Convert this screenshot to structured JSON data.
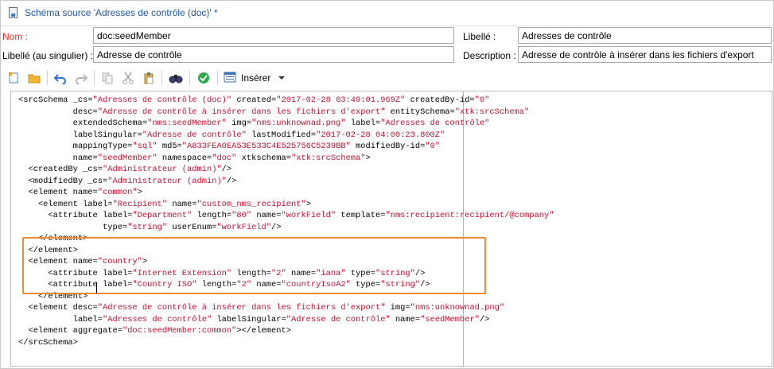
{
  "window": {
    "title": "Schéma source 'Adresses de contrôle (doc)' *"
  },
  "form": {
    "name_label": "Nom :",
    "name_value": "doc:seedMember",
    "label_label": "Libellé :",
    "label_value": "Adresses de contrôle",
    "singular_label": "Libellé (au singulier) :",
    "singular_value": "Adresse de contrôle",
    "description_label": "Description :",
    "description_value": "Adresse de contrôle à insérer dans les fichiers d'export"
  },
  "toolbar": {
    "insert_label": "Insérer",
    "icons": [
      "new-icon",
      "open-icon",
      "undo-icon",
      "redo-icon",
      "copy-icon",
      "cut-icon",
      "paste-icon",
      "find-icon",
      "check-icon",
      "insert-icon"
    ]
  },
  "editor": {
    "lines": [
      "<srcSchema _cs=\"Adresses de contrôle (doc)\" created=\"2017-02-28 03:49:01.969Z\" createdBy-id=\"0\"",
      "           desc=\"Adresse de contrôle à insérer dans les fichiers d'export\" entitySchema=\"xtk:srcSchema\"",
      "           extendedSchema=\"nms:seedMember\" img=\"nms:unknownad.png\" label=\"Adresses de contrôle\"",
      "           labelSingular=\"Adresse de contrôle\" lastModified=\"2017-02-28 04:00:23.800Z\"",
      "           mappingType=\"sql\" md5=\"A833FEA0EA53E533C4E525756C5239BB\" modifiedBy-id=\"0\"",
      "           name=\"seedMember\" namespace=\"doc\" xtkschema=\"xtk:srcSchema\">",
      "  <createdBy _cs=\"Administrateur (admin)\"/>",
      "  <modifiedBy _cs=\"Administrateur (admin)\"/>",
      "  <element name=\"common\">",
      "    <element label=\"Recipient\" name=\"custom_nms_recipient\">",
      "      <attribute label=\"Department\" length=\"80\" name=\"workField\" template=\"nms:recipient:recipient/@company\"",
      "                 type=\"string\" userEnum=\"workField\"/>",
      "    </element>",
      "  </element>",
      "  <element name=\"country\">",
      "      <attribute label=\"Internet Extension\" length=\"2\" name=\"iana\" type=\"string\"/>",
      "      <attribute label=\"Country ISO\" length=\"2\" name=\"countryIsoA2\" type=\"string\"/>",
      "    </element>",
      "  <element desc=\"Adresse de contrôle à insérer dans les fichiers d'export\" img=\"nms:unknownad.png\"",
      "           label=\"Adresses de contrôle\" labelSingular=\"Adresse de contrôle\" name=\"seedMember\"/>",
      "  <element aggregate=\"doc:seedMember:common\"></element>",
      "</srcSchema>"
    ]
  },
  "colors": {
    "highlight_border": "#f08c2c",
    "string_value": "#c8102e",
    "title_text": "#1f5aa8",
    "required_label": "#e0312a"
  }
}
